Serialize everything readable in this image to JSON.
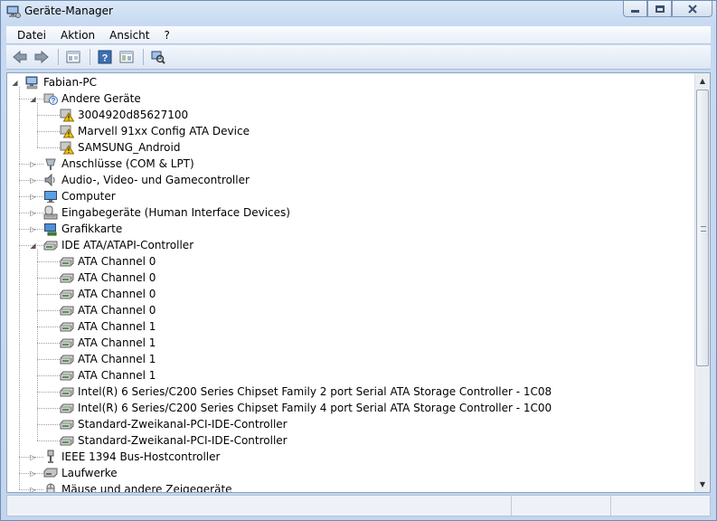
{
  "window": {
    "title": "Geräte-Manager"
  },
  "menu": [
    {
      "key": "datei",
      "label": "Datei"
    },
    {
      "key": "aktion",
      "label": "Aktion"
    },
    {
      "key": "ansicht",
      "label": "Ansicht"
    },
    {
      "key": "help",
      "label": "?"
    }
  ],
  "toolbar": [
    "back-icon",
    "forward-icon",
    "properties-view-icon",
    "help-icon",
    "console-tree-icon",
    "scan-hardware-icon"
  ],
  "tree": [
    {
      "level": 0,
      "label": "Fabian-PC",
      "icon": "computer",
      "expander": "open"
    },
    {
      "level": 1,
      "label": "Andere Geräte",
      "icon": "unknown",
      "expander": "open"
    },
    {
      "level": 2,
      "label": "3004920d85627100",
      "icon": "warning",
      "expander": "none"
    },
    {
      "level": 2,
      "label": "Marvell 91xx Config ATA Device",
      "icon": "warning",
      "expander": "none"
    },
    {
      "level": 2,
      "label": "SAMSUNG_Android",
      "icon": "warning",
      "expander": "none"
    },
    {
      "level": 1,
      "label": "Anschlüsse (COM & LPT)",
      "icon": "port",
      "expander": "closed"
    },
    {
      "level": 1,
      "label": "Audio-, Video- und Gamecontroller",
      "icon": "audio",
      "expander": "closed"
    },
    {
      "level": 1,
      "label": "Computer",
      "icon": "monitor",
      "expander": "closed"
    },
    {
      "level": 1,
      "label": "Eingabegeräte (Human Interface Devices)",
      "icon": "hid",
      "expander": "closed"
    },
    {
      "level": 1,
      "label": "Grafikkarte",
      "icon": "display",
      "expander": "closed"
    },
    {
      "level": 1,
      "label": "IDE ATA/ATAPI-Controller",
      "icon": "ide",
      "expander": "open"
    },
    {
      "level": 2,
      "label": "ATA Channel 0",
      "icon": "ide",
      "expander": "none"
    },
    {
      "level": 2,
      "label": "ATA Channel 0",
      "icon": "ide",
      "expander": "none"
    },
    {
      "level": 2,
      "label": "ATA Channel 0",
      "icon": "ide",
      "expander": "none"
    },
    {
      "level": 2,
      "label": "ATA Channel 0",
      "icon": "ide",
      "expander": "none"
    },
    {
      "level": 2,
      "label": "ATA Channel 1",
      "icon": "ide",
      "expander": "none"
    },
    {
      "level": 2,
      "label": "ATA Channel 1",
      "icon": "ide",
      "expander": "none"
    },
    {
      "level": 2,
      "label": "ATA Channel 1",
      "icon": "ide",
      "expander": "none"
    },
    {
      "level": 2,
      "label": "ATA Channel 1",
      "icon": "ide",
      "expander": "none"
    },
    {
      "level": 2,
      "label": "Intel(R) 6 Series/C200 Series Chipset Family 2 port Serial ATA Storage Controller - 1C08",
      "icon": "ide",
      "expander": "none"
    },
    {
      "level": 2,
      "label": "Intel(R) 6 Series/C200 Series Chipset Family 4 port Serial ATA Storage Controller - 1C00",
      "icon": "ide",
      "expander": "none"
    },
    {
      "level": 2,
      "label": "Standard-Zweikanal-PCI-IDE-Controller",
      "icon": "ide",
      "expander": "none"
    },
    {
      "level": 2,
      "label": "Standard-Zweikanal-PCI-IDE-Controller",
      "icon": "ide",
      "expander": "none"
    },
    {
      "level": 1,
      "label": "IEEE 1394 Bus-Hostcontroller",
      "icon": "firewire",
      "expander": "closed"
    },
    {
      "level": 1,
      "label": "Laufwerke",
      "icon": "drive",
      "expander": "closed"
    },
    {
      "level": 1,
      "label": "Mäuse und andere Zeigegeräte",
      "icon": "mouse",
      "expander": "closed"
    }
  ],
  "colors": {
    "accent": "#3b6fb0",
    "warning": "#f0c419"
  }
}
